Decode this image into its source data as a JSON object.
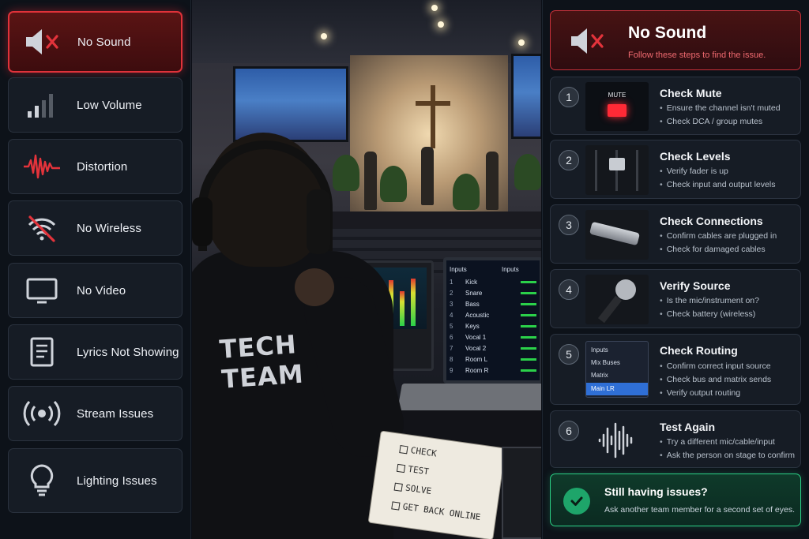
{
  "issues": [
    {
      "label": "No Sound",
      "icon": "speaker-muted-icon",
      "active": true
    },
    {
      "label": "Low Volume",
      "icon": "signal-bars-icon",
      "active": false
    },
    {
      "label": "Distortion",
      "icon": "waveform-icon",
      "active": false
    },
    {
      "label": "No Wireless",
      "icon": "wireless-off-icon",
      "active": false
    },
    {
      "label": "No Video",
      "icon": "monitor-icon",
      "active": false
    },
    {
      "label": "Lyrics Not Showing",
      "icon": "document-icon",
      "active": false
    },
    {
      "label": "Stream Issues",
      "icon": "broadcast-icon",
      "active": false
    },
    {
      "label": "Lighting Issues",
      "icon": "lightbulb-icon",
      "active": false
    }
  ],
  "header": {
    "title": "No Sound",
    "subtitle": "Follow these steps to find the issue.",
    "icon": "speaker-muted-icon"
  },
  "steps": [
    {
      "num": "1",
      "title": "Check Mute",
      "bullets": [
        "Ensure the channel isn't muted",
        "Check DCA / group mutes"
      ],
      "thumb_label": "MUTE"
    },
    {
      "num": "2",
      "title": "Check Levels",
      "bullets": [
        "Verify fader is up",
        "Check input and output levels"
      ]
    },
    {
      "num": "3",
      "title": "Check Connections",
      "bullets": [
        "Confirm cables are plugged in",
        "Check for damaged cables"
      ]
    },
    {
      "num": "4",
      "title": "Verify Source",
      "bullets": [
        "Is the mic/instrument on?",
        "Check battery (wireless)"
      ]
    },
    {
      "num": "5",
      "title": "Check Routing",
      "bullets": [
        "Confirm correct input source",
        "Check bus and matrix sends",
        "Verify output routing"
      ],
      "menu": [
        "Inputs",
        "Mix Buses",
        "Matrix",
        "Main LR"
      ],
      "menu_selected": "Main LR"
    },
    {
      "num": "6",
      "title": "Test Again",
      "bullets": [
        "Try a different mic/cable/input",
        "Ask the person on stage to confirm"
      ]
    }
  ],
  "still": {
    "title": "Still having issues?",
    "subtitle": "Ask another team member for a second set of eyes."
  },
  "photo": {
    "shirt_line1": "TECH",
    "shirt_line2": "TEAM",
    "laptop_header_left": "Inputs",
    "laptop_header_right": "Inputs",
    "laptop_channels": [
      {
        "n": "1",
        "name": "Kick"
      },
      {
        "n": "2",
        "name": "Snare"
      },
      {
        "n": "3",
        "name": "Bass"
      },
      {
        "n": "4",
        "name": "Acoustic"
      },
      {
        "n": "5",
        "name": "Keys"
      },
      {
        "n": "6",
        "name": "Vocal 1"
      },
      {
        "n": "7",
        "name": "Vocal 2"
      },
      {
        "n": "8",
        "name": "Room L"
      },
      {
        "n": "9",
        "name": "Room R"
      }
    ],
    "notebook": [
      "CHECK",
      "TEST",
      "SOLVE",
      "GET BACK ONLINE"
    ]
  },
  "colors": {
    "active_red": "#e0323a",
    "success_green": "#2bd186",
    "panel_bg": "#161c25"
  }
}
